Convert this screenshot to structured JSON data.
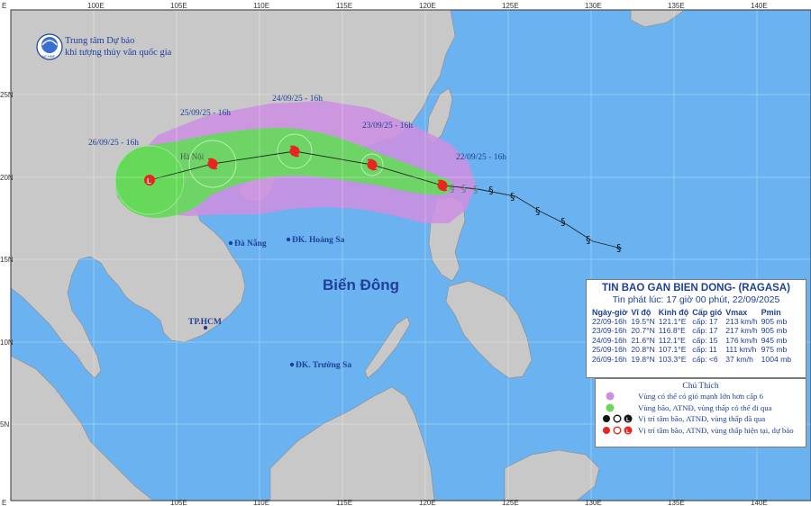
{
  "agency": {
    "line1": "Trung tâm Dự báo",
    "line2": "khí tượng thủy văn quốc gia",
    "logo_text": "NCHMF"
  },
  "axes": {
    "lon_labels": [
      "100E",
      "105E",
      "110E",
      "115E",
      "120E",
      "125E",
      "130E",
      "135E",
      "140E"
    ],
    "lon_labels_bottom": [
      "105E",
      "110E",
      "115E",
      "120E",
      "125E",
      "130E",
      "135E",
      "140E"
    ],
    "lat_labels": [
      "25N",
      "20N",
      "15N",
      "10N",
      "5N"
    ],
    "corner_label": "E"
  },
  "places": {
    "ha_noi": "Hà Nội",
    "da_nang": "Đà Nẵng",
    "hoang_sa": "ĐK. Hoàng Sa",
    "hcm": "TP.HCM",
    "truong_sa": "ĐK. Trường Sa",
    "sea": "Biển Đông"
  },
  "track_labels": {
    "d26": "26/09/25 - 16h",
    "d25": "25/09/25 - 16h",
    "d24": "24/09/25 - 16h",
    "d23": "23/09/25 - 16h",
    "d22": "22/09/25 - 16h"
  },
  "info": {
    "title": "TIN BAO GAN BIEN DONG- (RAGASA)",
    "issued": "Tin phát lúc: 17 giờ 00 phút, 22/09/2025",
    "headers": [
      "Ngày-giờ",
      "Vĩ độ",
      "Kinh độ",
      "Cấp gió",
      "Vmax",
      "Pmin"
    ],
    "rows": [
      [
        "22/09-16h",
        "19.5°N",
        "121.1°E",
        "cấp: 17",
        "213 km/h",
        "905 mb"
      ],
      [
        "23/09-16h",
        "20.7°N",
        "116.8°E",
        "cấp: 17",
        "217 km/h",
        "905 mb"
      ],
      [
        "24/09-16h",
        "21.6°N",
        "112.1°E",
        "cấp: 15",
        "176 km/h",
        "945 mb"
      ],
      [
        "25/09-16h",
        "20.8°N",
        "107.1°E",
        "cấp: 11",
        "111 km/h",
        "975 mb"
      ],
      [
        "26/09-16h",
        "19.8°N",
        "103.3°E",
        "cấp: <6",
        "37 km/h",
        "1004 mb"
      ]
    ]
  },
  "legend": {
    "title": "Chú Thích",
    "items": [
      {
        "text": "Vùng có thể có gió mạnh lớn hơn cấp 6",
        "color": "#cc8fe0",
        "icon": "purple-dot"
      },
      {
        "text": "Vùng bão, ATNĐ, vùng thấp có thể đi qua",
        "color": "#66d95a",
        "icon": "green-dot"
      },
      {
        "text": "Vị trí tâm bão, ATNĐ, vùng thấp đã qua",
        "color": "#000000",
        "icon": "past-storm-symbols"
      },
      {
        "text": "Vị trí tâm bão, ATNĐ, vùng thấp hiện tại, dự báo",
        "color": "#e8261f",
        "icon": "forecast-storm-symbols"
      }
    ]
  },
  "colors": {
    "sea": "#6ab3f0",
    "land": "#c8c8c8",
    "wind_zone": "#cc8fe0",
    "storm_zone": "#66d95a",
    "storm_symbol": "#e8261f",
    "label_blue": "#1f3f9a"
  }
}
